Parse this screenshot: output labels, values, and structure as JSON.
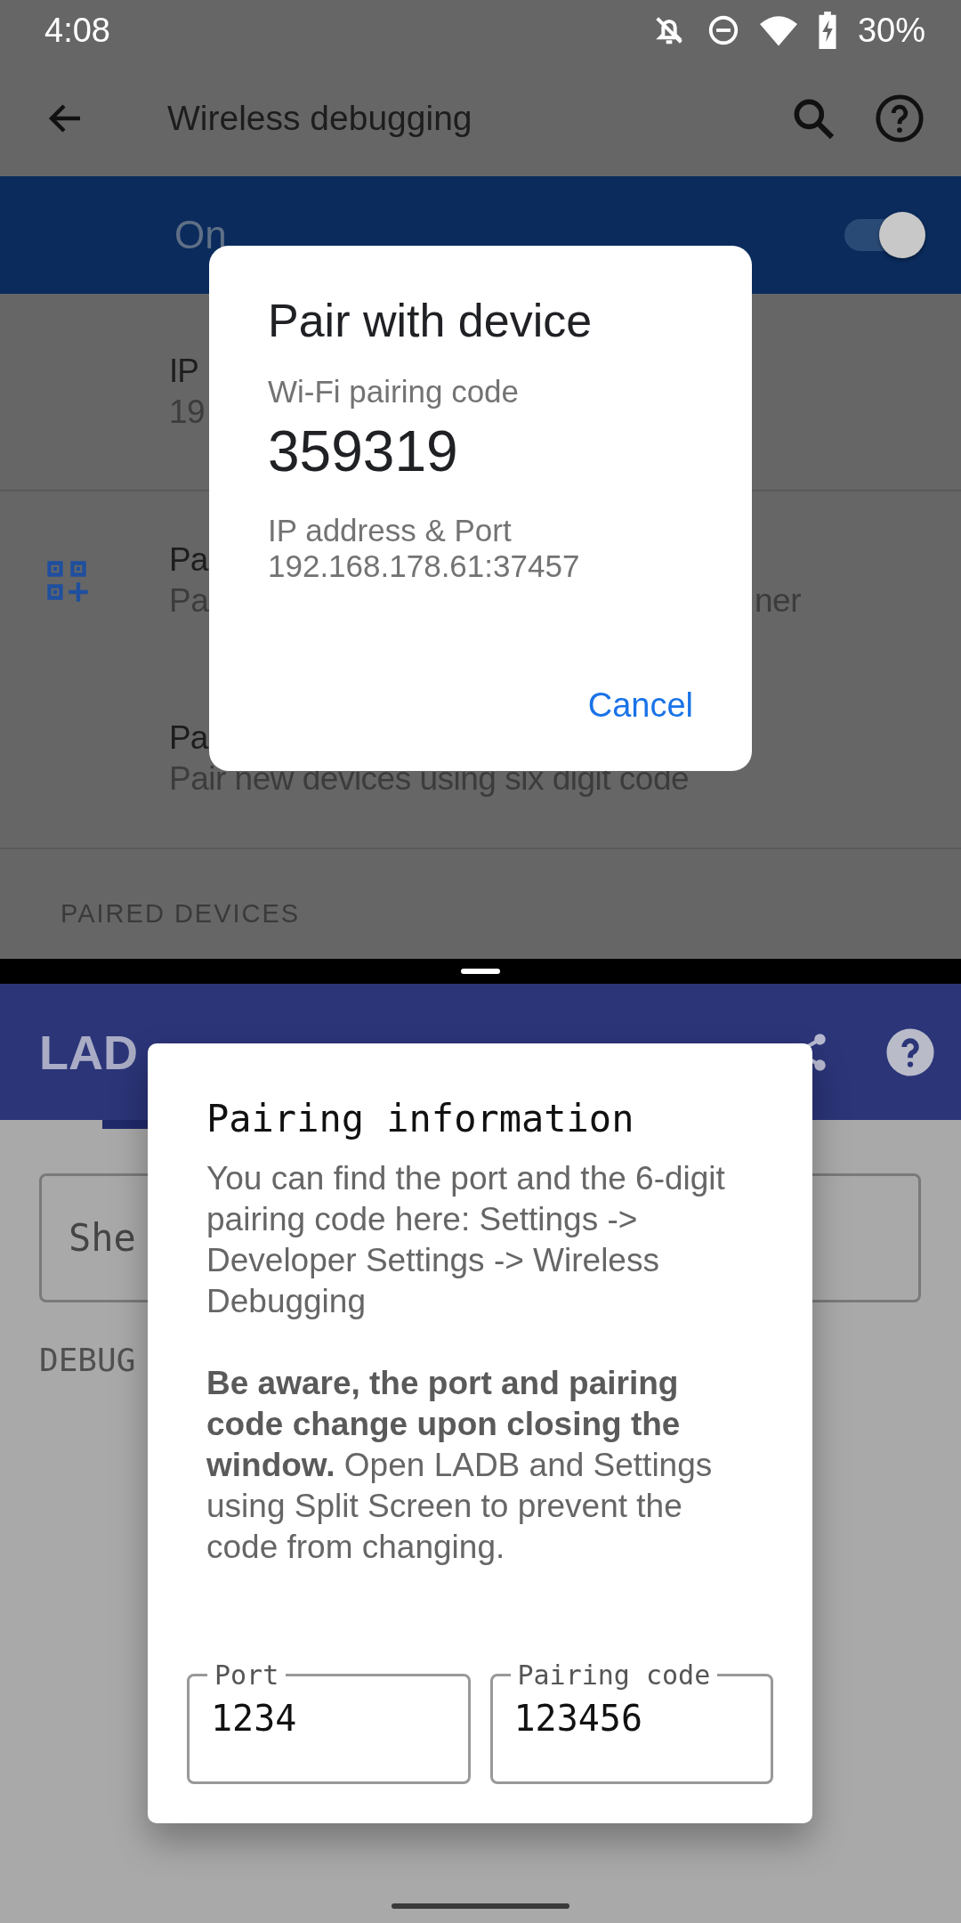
{
  "status_bar": {
    "time": "4:08",
    "battery": "30%"
  },
  "settings": {
    "title": "Wireless debugging",
    "toggle": {
      "label": "On",
      "on": true
    },
    "ip_row": {
      "title": "IP",
      "subtitle": "19"
    },
    "qr_row": {
      "title": "Pa",
      "subtitle": "Pa",
      "subtitle_end": "ner"
    },
    "code_row": {
      "title": "Pa",
      "subtitle": "Pair new devices using six digit code"
    },
    "section_header": "PAIRED DEVICES"
  },
  "pair_dialog": {
    "title": "Pair with device",
    "code_label": "Wi-Fi pairing code",
    "code": "359319",
    "address_label": "IP address & Port",
    "address": "192.168.178.61:37457",
    "button": "Cancel"
  },
  "ladb": {
    "title": "LAD",
    "shell_field": {
      "placeholder": "She"
    },
    "section_label": "DEBUG"
  },
  "info_dialog": {
    "title": "Pairing information",
    "paragraphs": [
      "You can find the port and the 6-digit pairing code here: Settings -> Developer Settings -> Wireless Debugging",
      "**Be aware, the port and pairing code change upon closing the window.** Open LADB and Settings using Split Screen to prevent the code from changing."
    ],
    "fields": [
      {
        "label": "Port",
        "value": "1234"
      },
      {
        "label": "Pairing code",
        "value": "123456"
      }
    ]
  }
}
